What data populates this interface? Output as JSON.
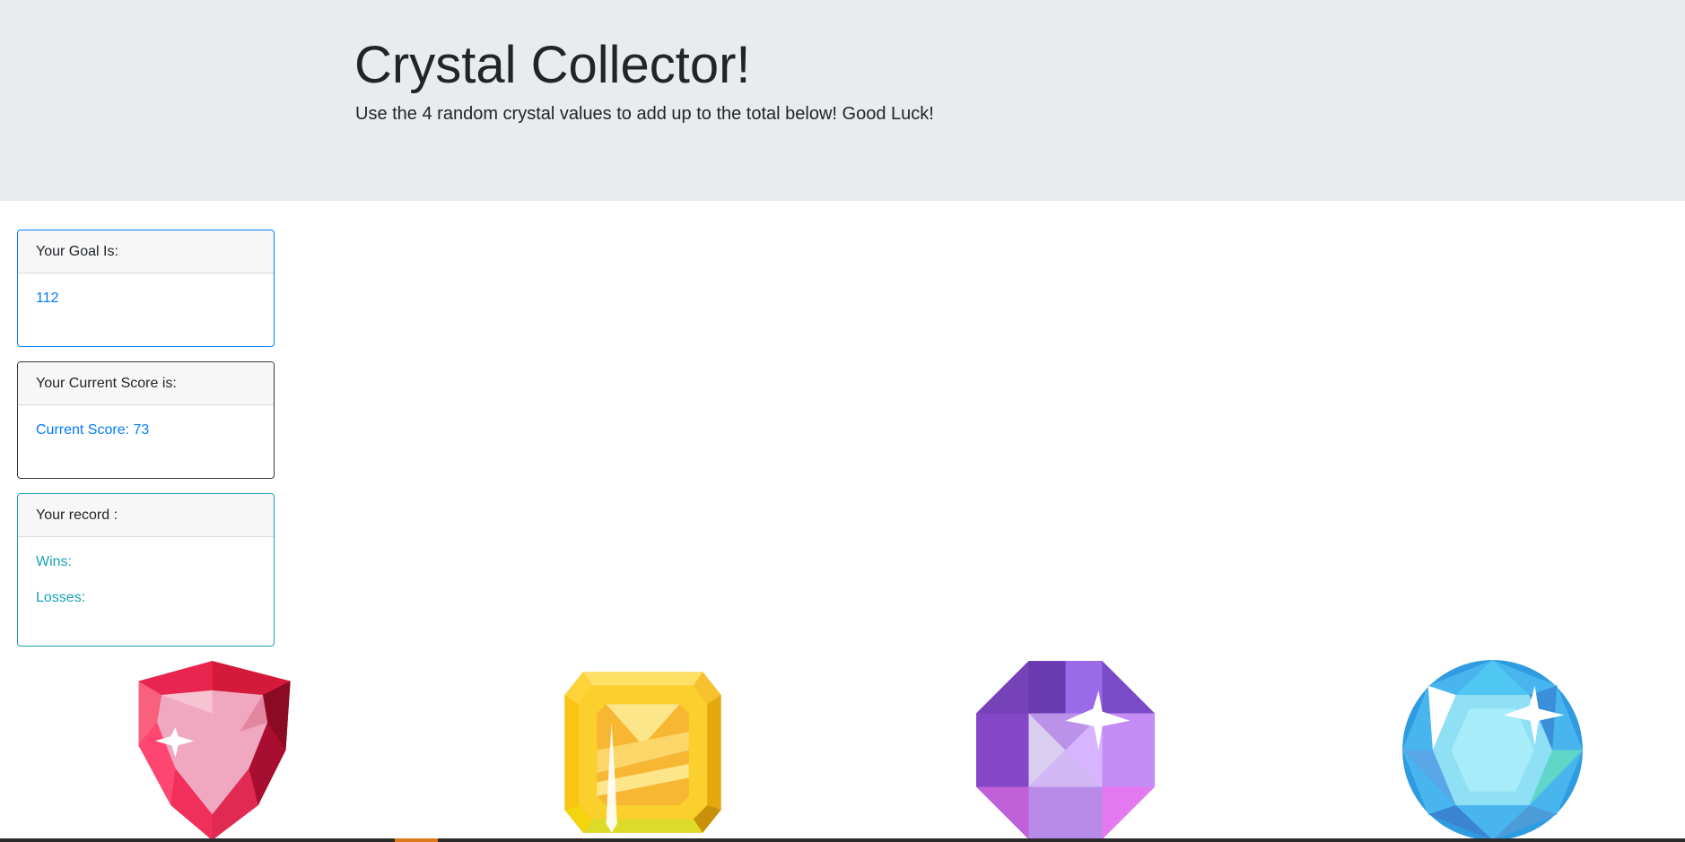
{
  "header": {
    "title": "Crystal Collector!",
    "subtitle": "Use the 4 random crystal values to add up to the total below! Good Luck!"
  },
  "goal_card": {
    "header": "Your Goal Is:",
    "value": "112"
  },
  "score_card": {
    "header": "Your Current Score is:",
    "value": "Current Score: 73"
  },
  "record_card": {
    "header": "Your record :",
    "wins_label": "Wins:",
    "losses_label": "Losses:"
  },
  "crystals": [
    {
      "name": "red-crystal",
      "color": "#e8254f"
    },
    {
      "name": "yellow-crystal",
      "color": "#f5c518"
    },
    {
      "name": "purple-crystal",
      "color": "#a35be0"
    },
    {
      "name": "blue-crystal",
      "color": "#3aa8ea"
    }
  ],
  "colors": {
    "jumbotron_bg": "#e9ecef",
    "primary": "#007bff",
    "info": "#17a2b8",
    "dark": "#343a40"
  }
}
